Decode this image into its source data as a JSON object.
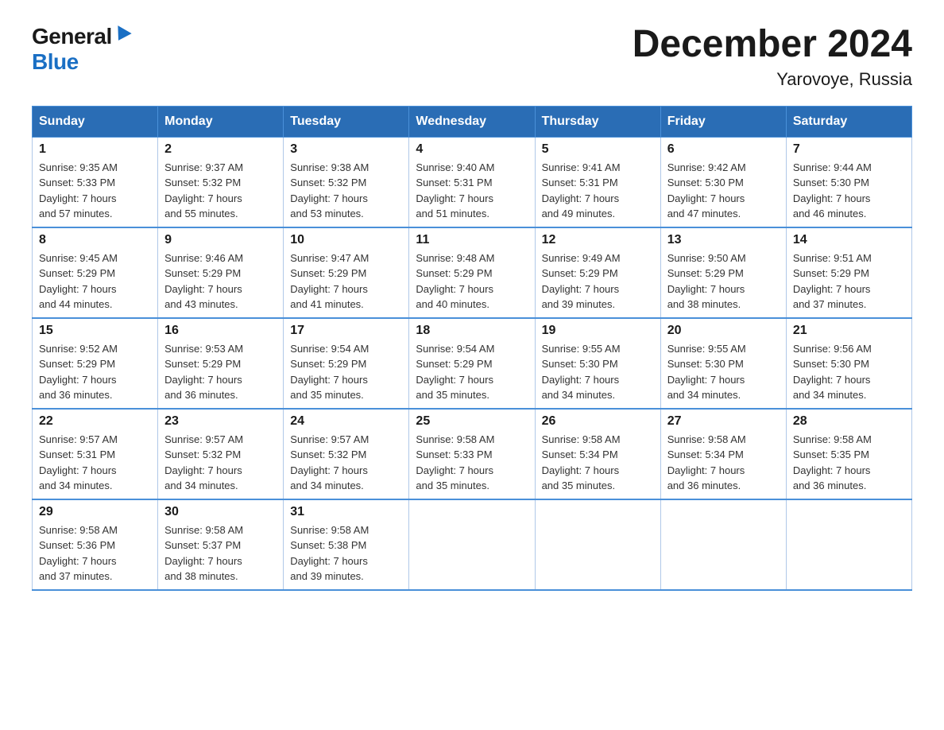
{
  "logo": {
    "general": "General",
    "blue": "Blue"
  },
  "title": "December 2024",
  "subtitle": "Yarovoye, Russia",
  "days_of_week": [
    "Sunday",
    "Monday",
    "Tuesday",
    "Wednesday",
    "Thursday",
    "Friday",
    "Saturday"
  ],
  "weeks": [
    [
      {
        "day": "1",
        "sunrise": "9:35 AM",
        "sunset": "5:33 PM",
        "daylight": "7 hours and 57 minutes."
      },
      {
        "day": "2",
        "sunrise": "9:37 AM",
        "sunset": "5:32 PM",
        "daylight": "7 hours and 55 minutes."
      },
      {
        "day": "3",
        "sunrise": "9:38 AM",
        "sunset": "5:32 PM",
        "daylight": "7 hours and 53 minutes."
      },
      {
        "day": "4",
        "sunrise": "9:40 AM",
        "sunset": "5:31 PM",
        "daylight": "7 hours and 51 minutes."
      },
      {
        "day": "5",
        "sunrise": "9:41 AM",
        "sunset": "5:31 PM",
        "daylight": "7 hours and 49 minutes."
      },
      {
        "day": "6",
        "sunrise": "9:42 AM",
        "sunset": "5:30 PM",
        "daylight": "7 hours and 47 minutes."
      },
      {
        "day": "7",
        "sunrise": "9:44 AM",
        "sunset": "5:30 PM",
        "daylight": "7 hours and 46 minutes."
      }
    ],
    [
      {
        "day": "8",
        "sunrise": "9:45 AM",
        "sunset": "5:29 PM",
        "daylight": "7 hours and 44 minutes."
      },
      {
        "day": "9",
        "sunrise": "9:46 AM",
        "sunset": "5:29 PM",
        "daylight": "7 hours and 43 minutes."
      },
      {
        "day": "10",
        "sunrise": "9:47 AM",
        "sunset": "5:29 PM",
        "daylight": "7 hours and 41 minutes."
      },
      {
        "day": "11",
        "sunrise": "9:48 AM",
        "sunset": "5:29 PM",
        "daylight": "7 hours and 40 minutes."
      },
      {
        "day": "12",
        "sunrise": "9:49 AM",
        "sunset": "5:29 PM",
        "daylight": "7 hours and 39 minutes."
      },
      {
        "day": "13",
        "sunrise": "9:50 AM",
        "sunset": "5:29 PM",
        "daylight": "7 hours and 38 minutes."
      },
      {
        "day": "14",
        "sunrise": "9:51 AM",
        "sunset": "5:29 PM",
        "daylight": "7 hours and 37 minutes."
      }
    ],
    [
      {
        "day": "15",
        "sunrise": "9:52 AM",
        "sunset": "5:29 PM",
        "daylight": "7 hours and 36 minutes."
      },
      {
        "day": "16",
        "sunrise": "9:53 AM",
        "sunset": "5:29 PM",
        "daylight": "7 hours and 36 minutes."
      },
      {
        "day": "17",
        "sunrise": "9:54 AM",
        "sunset": "5:29 PM",
        "daylight": "7 hours and 35 minutes."
      },
      {
        "day": "18",
        "sunrise": "9:54 AM",
        "sunset": "5:29 PM",
        "daylight": "7 hours and 35 minutes."
      },
      {
        "day": "19",
        "sunrise": "9:55 AM",
        "sunset": "5:30 PM",
        "daylight": "7 hours and 34 minutes."
      },
      {
        "day": "20",
        "sunrise": "9:55 AM",
        "sunset": "5:30 PM",
        "daylight": "7 hours and 34 minutes."
      },
      {
        "day": "21",
        "sunrise": "9:56 AM",
        "sunset": "5:30 PM",
        "daylight": "7 hours and 34 minutes."
      }
    ],
    [
      {
        "day": "22",
        "sunrise": "9:57 AM",
        "sunset": "5:31 PM",
        "daylight": "7 hours and 34 minutes."
      },
      {
        "day": "23",
        "sunrise": "9:57 AM",
        "sunset": "5:32 PM",
        "daylight": "7 hours and 34 minutes."
      },
      {
        "day": "24",
        "sunrise": "9:57 AM",
        "sunset": "5:32 PM",
        "daylight": "7 hours and 34 minutes."
      },
      {
        "day": "25",
        "sunrise": "9:58 AM",
        "sunset": "5:33 PM",
        "daylight": "7 hours and 35 minutes."
      },
      {
        "day": "26",
        "sunrise": "9:58 AM",
        "sunset": "5:34 PM",
        "daylight": "7 hours and 35 minutes."
      },
      {
        "day": "27",
        "sunrise": "9:58 AM",
        "sunset": "5:34 PM",
        "daylight": "7 hours and 36 minutes."
      },
      {
        "day": "28",
        "sunrise": "9:58 AM",
        "sunset": "5:35 PM",
        "daylight": "7 hours and 36 minutes."
      }
    ],
    [
      {
        "day": "29",
        "sunrise": "9:58 AM",
        "sunset": "5:36 PM",
        "daylight": "7 hours and 37 minutes."
      },
      {
        "day": "30",
        "sunrise": "9:58 AM",
        "sunset": "5:37 PM",
        "daylight": "7 hours and 38 minutes."
      },
      {
        "day": "31",
        "sunrise": "9:58 AM",
        "sunset": "5:38 PM",
        "daylight": "7 hours and 39 minutes."
      },
      null,
      null,
      null,
      null
    ]
  ],
  "labels": {
    "sunrise": "Sunrise:",
    "sunset": "Sunset:",
    "daylight": "Daylight:"
  }
}
